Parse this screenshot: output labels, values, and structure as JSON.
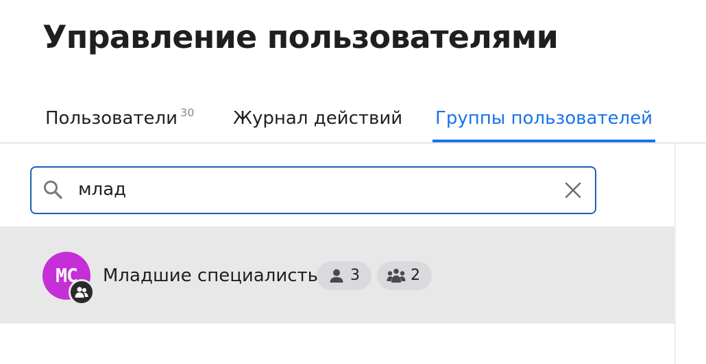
{
  "page": {
    "title": "Управление пользователями"
  },
  "tabs": [
    {
      "label": "Пользователи",
      "count": "30",
      "active": false
    },
    {
      "label": "Журнал действий",
      "active": false
    },
    {
      "label": "Группы пользователей",
      "active": true
    }
  ],
  "search": {
    "value": "млад",
    "icon": "search-icon",
    "clear_icon": "close-icon"
  },
  "groups": [
    {
      "initials": "МС",
      "name": "Младшие специалисты",
      "avatar_color": "#c42fd8",
      "badge_icon": "group-icon",
      "members_count": "3",
      "subgroups_count": "2"
    }
  ],
  "colors": {
    "accent": "#1a73e8",
    "search_border": "#1a5fb4",
    "row_background": "#e8e8e9",
    "chip_background": "#d9dadd"
  }
}
